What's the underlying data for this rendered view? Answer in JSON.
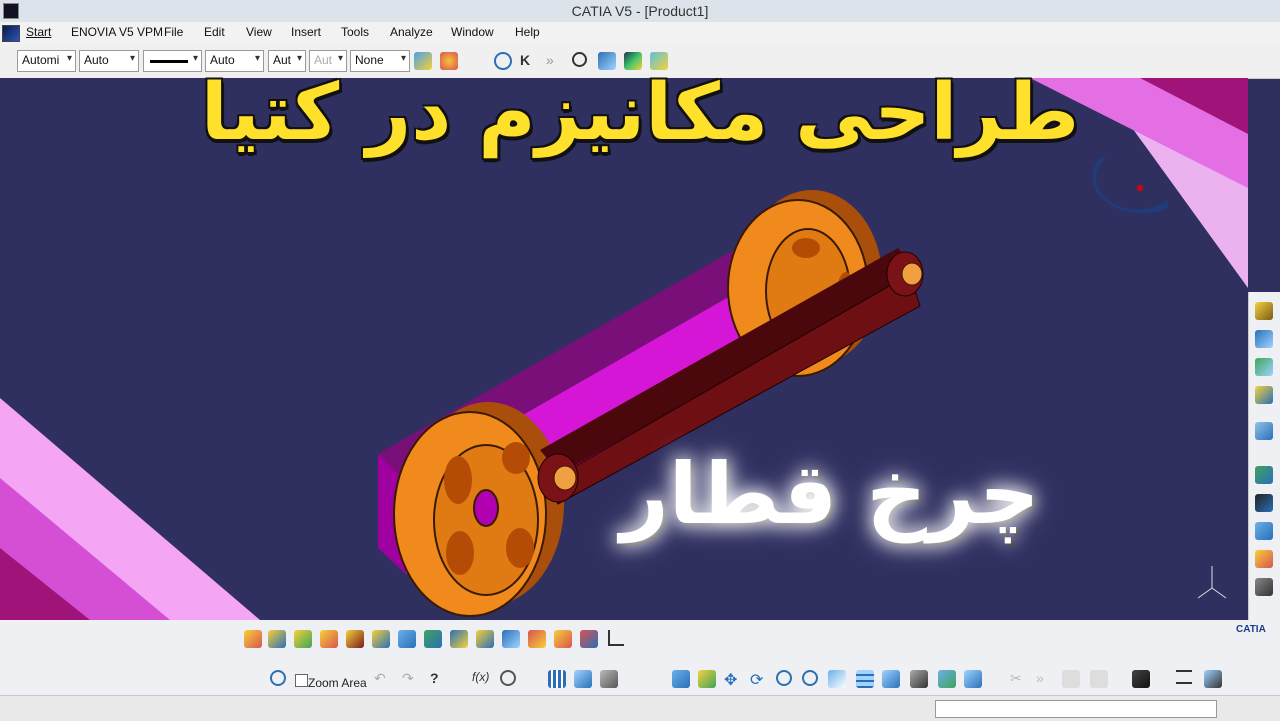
{
  "window": {
    "title": "CATIA V5 - [Product1]"
  },
  "menu": {
    "items": [
      "Start",
      "ENOVIA V5 VPM",
      "File",
      "Edit",
      "View",
      "Insert",
      "Tools",
      "Analyze",
      "Window",
      "Help"
    ]
  },
  "toolbar": {
    "combos": [
      {
        "value": "Automi",
        "enabled": true
      },
      {
        "value": "Auto",
        "enabled": true
      },
      {
        "value": "",
        "enabled": true
      },
      {
        "value": "Auto",
        "enabled": true
      },
      {
        "value": "Aut",
        "enabled": true
      },
      {
        "value": "Aut",
        "enabled": false
      },
      {
        "value": "None",
        "enabled": true
      }
    ]
  },
  "overlay": {
    "title": "طراحی مکانیزم در کتیا",
    "subtitle": "چرخ قطار"
  },
  "bottom": {
    "zoom_area_label": "Zoom Area"
  },
  "compass": {
    "x": "x",
    "y": "y",
    "z": "z"
  },
  "logo": {
    "brand": "CATIA"
  },
  "colors": {
    "viewport_bg": "#2f2f60",
    "wheel": "#f08a1c",
    "rod": "#6e0f14",
    "base": "#d616d6",
    "title_text": "#ffe02a",
    "banner_pink": "#f2a3f2"
  }
}
